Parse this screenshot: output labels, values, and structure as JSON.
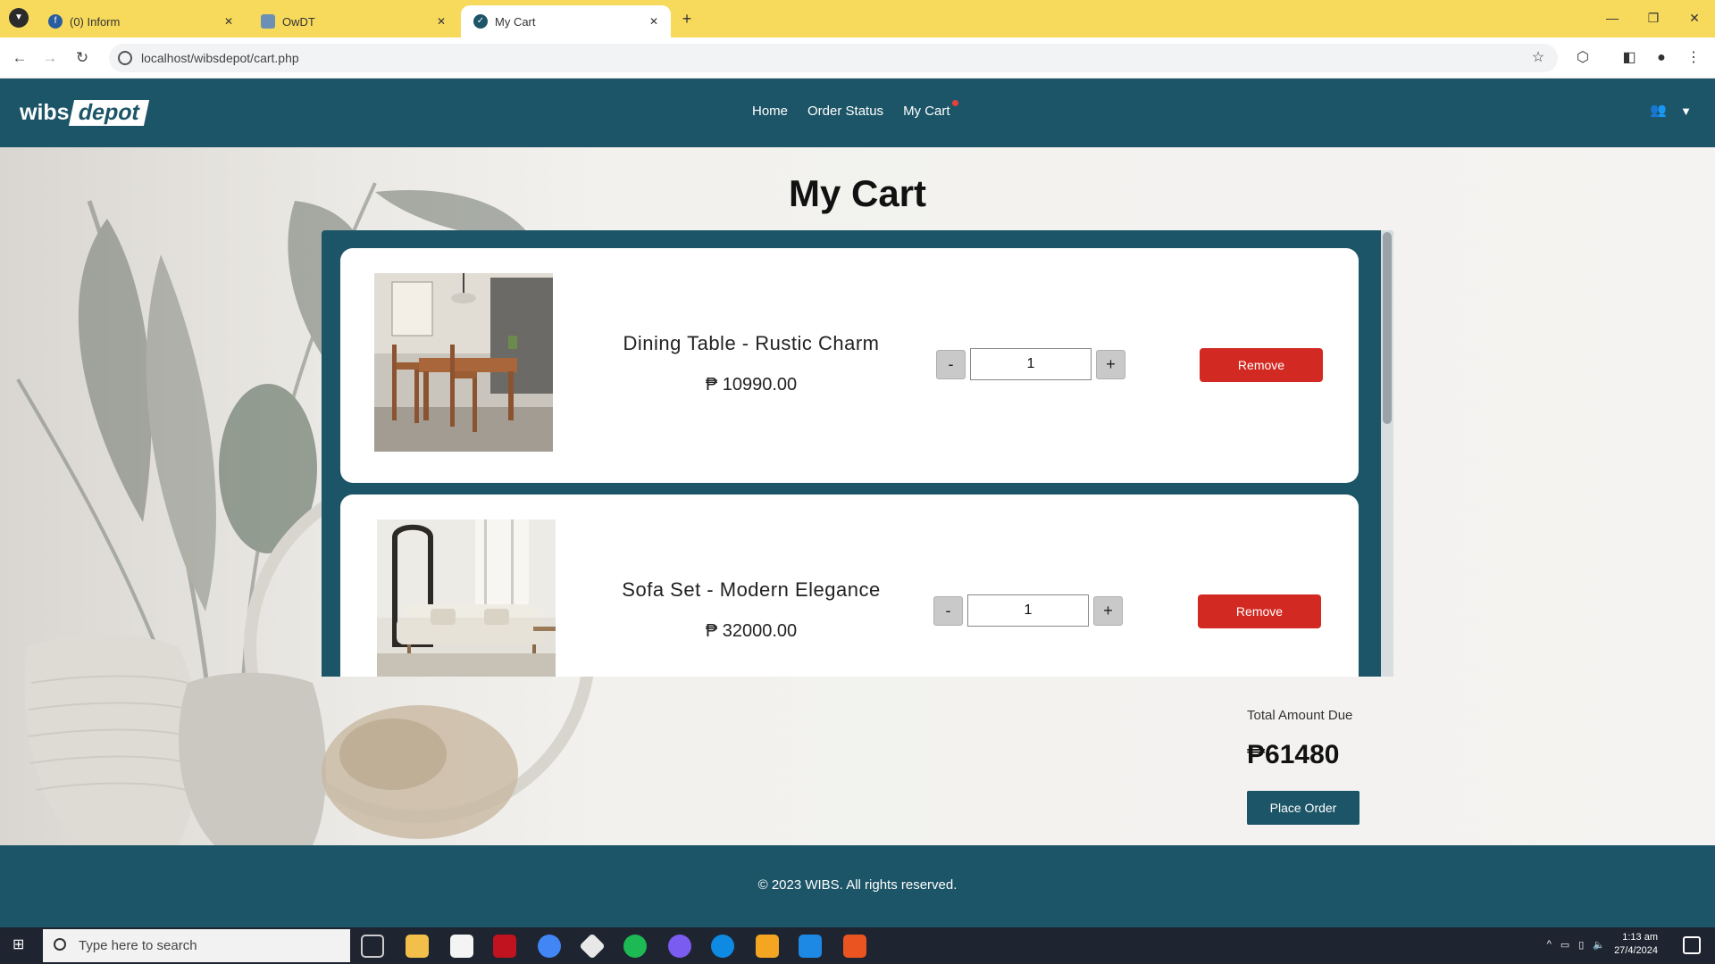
{
  "browser": {
    "tabs": [
      {
        "title": "(0) Inform",
        "active": false
      },
      {
        "title": "OwDT",
        "active": false
      },
      {
        "title": "My Cart",
        "active": true
      }
    ],
    "url": "localhost/wibsdepot/cart.php"
  },
  "site": {
    "logo_part1": "wibs",
    "logo_part2": "depot",
    "nav": {
      "home": "Home",
      "order_status": "Order Status",
      "my_cart": "My Cart"
    }
  },
  "page": {
    "title": "My Cart"
  },
  "cart": {
    "items": [
      {
        "name": "Dining Table - Rustic Charm",
        "price": "₱ 10990.00",
        "quantity": "1",
        "remove_label": "Remove"
      },
      {
        "name": "Sofa Set - Modern Elegance",
        "price": "₱ 32000.00",
        "quantity": "1",
        "remove_label": "Remove"
      }
    ],
    "decrement_label": "-",
    "increment_label": "+",
    "total_label": "Total Amount Due",
    "total_value": "₱61480",
    "place_order_label": "Place Order"
  },
  "footer": {
    "text": "© 2023 WIBS. All rights reserved."
  },
  "taskbar": {
    "search_placeholder": "Type here to search",
    "clock_time": "1:13 am",
    "clock_date": "27/4/2024"
  },
  "colors": {
    "brand": "#1c5567",
    "remove": "#d22a22",
    "tab_bar": "#f7da5c"
  }
}
